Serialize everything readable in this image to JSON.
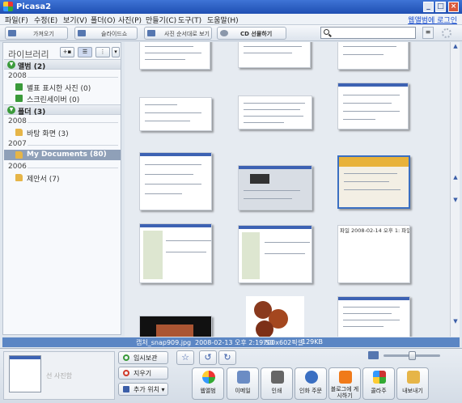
{
  "window": {
    "title": "Picasa2"
  },
  "menu": {
    "items": [
      "파일(F)",
      "수정(E)",
      "보기(V)",
      "폴더(O)",
      "사진(P)",
      "만들기(C)",
      "도구(T)",
      "도움말(H)"
    ],
    "login": "웹앨범에 로그인"
  },
  "toolbar": {
    "import": "가져오기",
    "slideshow": "슬라이드쇼",
    "timeline": "사진 순서대로 보기",
    "cd": "CD 선물하기",
    "search_value": ""
  },
  "sidebar": {
    "title": "라이브러리",
    "albums_header": {
      "label": "앨범",
      "count": "(2)"
    },
    "folders_header": {
      "label": "폴더",
      "count": "(3)"
    },
    "years": [
      "2008",
      "2008",
      "2007",
      "2006"
    ],
    "albums": [
      {
        "label": "별표 표시한 사진 (0)"
      },
      {
        "label": "스크린세이버 (0)"
      }
    ],
    "folders": [
      {
        "label": "바탕 화면 (3)"
      },
      {
        "label": "My Documents (80)",
        "selected": true
      },
      {
        "label": "제안서 (7)"
      }
    ]
  },
  "thumbnails": [
    {
      "text": ""
    },
    {
      "text": ""
    },
    {
      "text": ""
    },
    {
      "text": ""
    },
    {
      "text": ""
    },
    {
      "text": ""
    },
    {
      "text": ""
    },
    {
      "text": ""
    },
    {
      "text": ""
    },
    {
      "text": ""
    },
    {
      "text": ""
    },
    {
      "text": "파일 2008-02-14 오후 1:\n파일 2008-02-14 오후 2:\n파일 2008-02-14 오후 3:\n파일 2008-02-14 오후 2:\n파일 2008-02-14 오후 2:\nGOM 미디어... 2008-02-14 오후 2:\nMSF 파일 2008-02-14 오후 2:\nMSF 파일 2008-02-14 오후 2:"
    },
    {
      "text": ""
    },
    {
      "text": ""
    },
    {
      "text": ""
    }
  ],
  "status": {
    "filename": "캡처_snap909.jpg",
    "date": "2008-02-13 오후 2:19:50",
    "dims": "700x602픽셀",
    "size": "129KB"
  },
  "bottom": {
    "tray_text": "선 사진함",
    "hold": "임시보관",
    "clear": "지우기",
    "add": "추가 위치",
    "actions": [
      "웹앨범",
      "이메일",
      "인쇄",
      "인화 주문",
      "블로그에 게시하기",
      "콜라주",
      "내보내기"
    ]
  }
}
